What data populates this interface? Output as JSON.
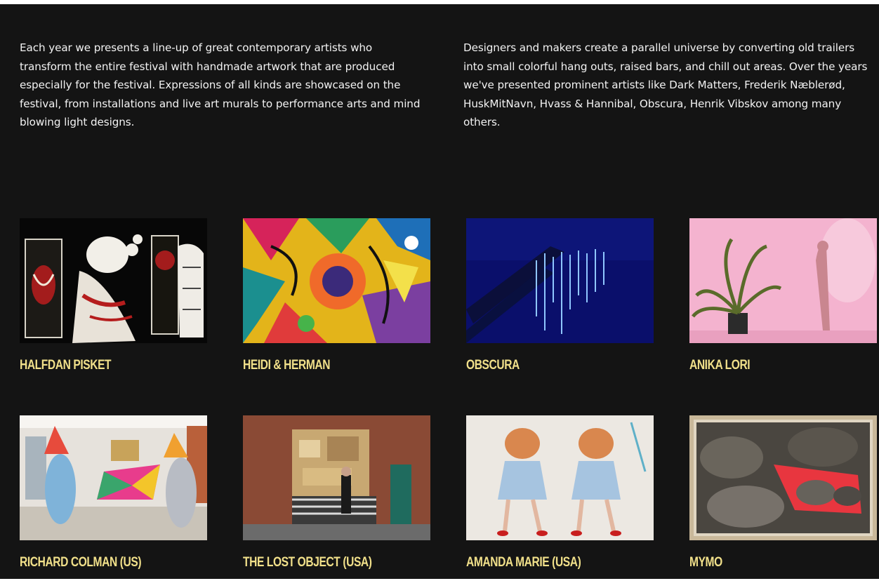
{
  "intro": {
    "left": "Each year we presents a line-up of great contemporary artists who transform the entire festival with handmade artwork that are produced especially for the festival. Expressions of all kinds are showcased on the festival, from installations and live art murals to performance arts and mind blowing light designs.",
    "right": "Designers and makers create a parallel universe by converting old trailers into small colorful hang outs, raised bars, and chill out areas.  Over the years we've presented prominent artists like Dark Matters, Frederik Næblerød, HuskMitNavn, Hvass & Hannibal, Obscura, Henrik Vibskov among many others."
  },
  "artists": [
    {
      "name": "HALFDAN PISKET"
    },
    {
      "name": "HEIDI & HERMAN"
    },
    {
      "name": "OBSCURA"
    },
    {
      "name": "ANIKA LORI"
    },
    {
      "name": "RICHARD COLMAN (US)"
    },
    {
      "name": "THE LOST OBJECT (USA)"
    },
    {
      "name": "AMANDA MARIE (USA)"
    },
    {
      "name": "MYMO"
    }
  ],
  "colors": {
    "background": "#141414",
    "text": "#f2f2f2",
    "accent": "#f1e08a"
  }
}
